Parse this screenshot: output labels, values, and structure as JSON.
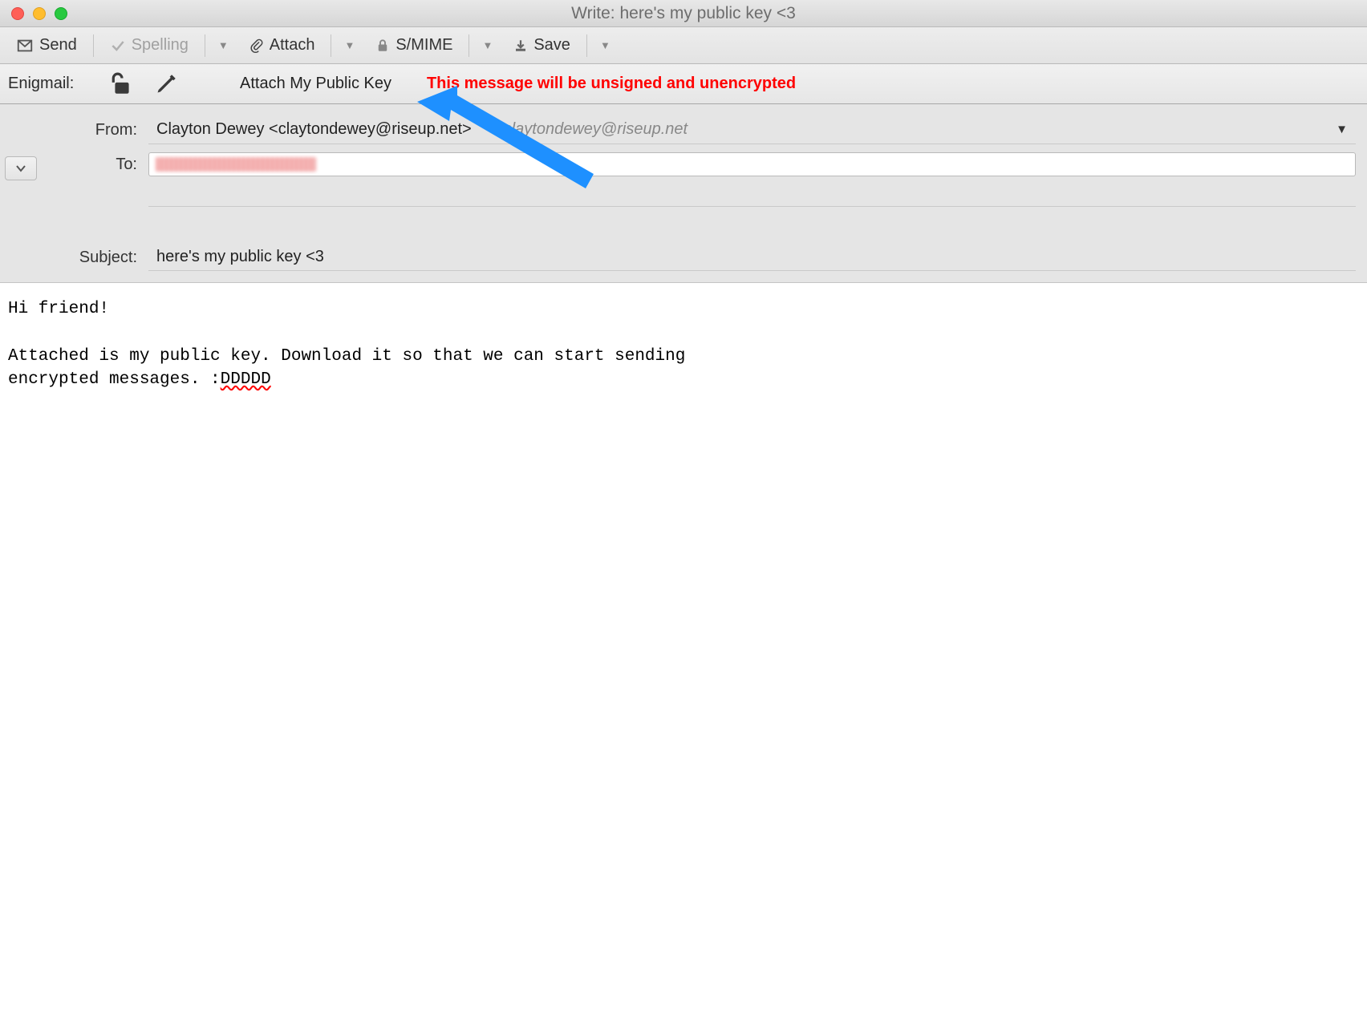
{
  "window": {
    "title": "Write: here's my public key <3"
  },
  "toolbar": {
    "send": "Send",
    "spelling": "Spelling",
    "attach": "Attach",
    "smime": "S/MIME",
    "save": "Save"
  },
  "enigmail": {
    "label": "Enigmail:",
    "attach_key": "Attach My Public Key",
    "warning": "This message will be unsigned and unencrypted"
  },
  "headers": {
    "from_label": "From:",
    "from_value": "Clayton Dewey <claytondewey@riseup.net>",
    "from_identity": "claytondewey@riseup.net",
    "to_label": "To:",
    "subject_label": "Subject:",
    "subject_value": "here's my public key <3"
  },
  "body": {
    "line1": "Hi friend!",
    "line2": "Attached is my public key. Download it so that we can start sending",
    "line3_a": "encrypted messages. :",
    "line3_b": "DDDDD"
  }
}
